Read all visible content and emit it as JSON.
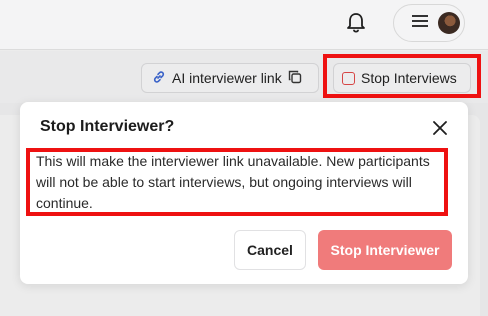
{
  "header": {
    "notification_icon": "bell-icon",
    "menu_icon": "hamburger-menu-icon",
    "avatar": "user-avatar"
  },
  "toolbar": {
    "ai_link_label": "AI interviewer link",
    "ai_link_icon": "link-icon",
    "copy_icon": "copy-icon",
    "stop_label": "Stop Interviews",
    "stop_icon": "stop-square-icon"
  },
  "modal": {
    "title": "Stop Interviewer?",
    "close_icon": "close-icon",
    "body": "This will make the interviewer link unavailable. New participants will not be able to start interviews, but ongoing interviews will continue.",
    "cancel_label": "Cancel",
    "confirm_label": "Stop Interviewer"
  },
  "colors": {
    "highlight": "#ee1111",
    "confirm_button": "#f07b7b",
    "stop_icon": "#d64545"
  }
}
